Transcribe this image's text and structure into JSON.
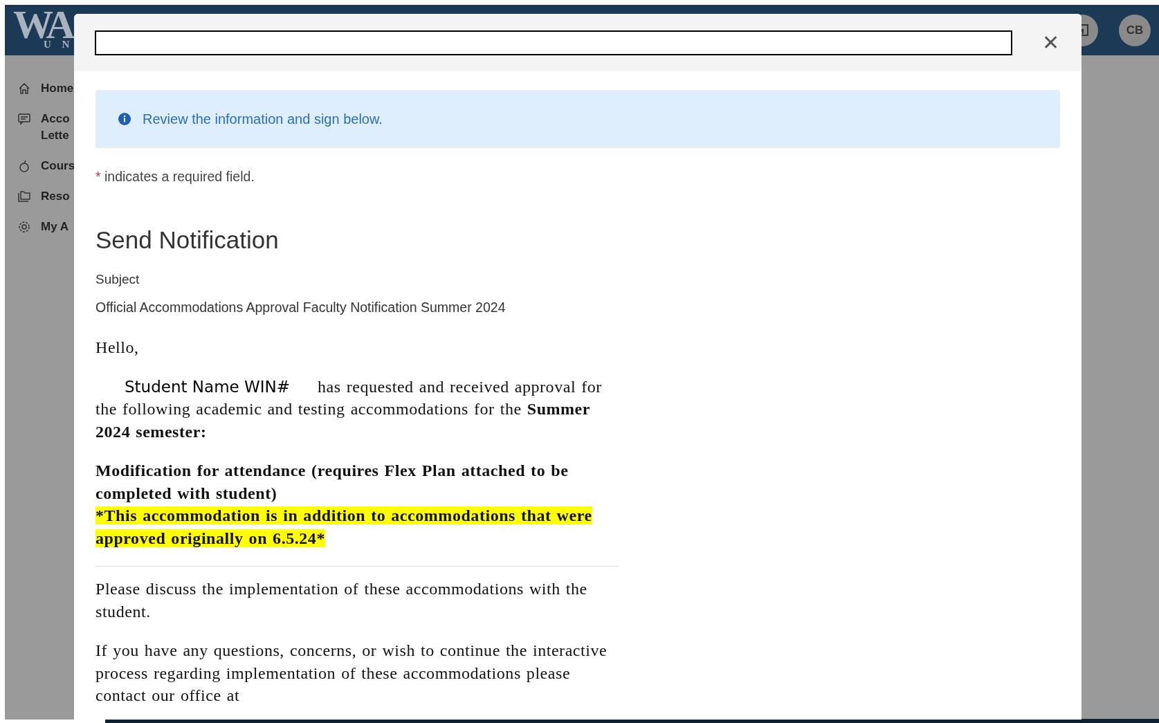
{
  "header": {
    "logo_text": "WA",
    "logo_subtext": "U N",
    "avatar": "CB"
  },
  "sidebar": {
    "items": [
      {
        "label": "Home"
      },
      {
        "label": "Acco",
        "label_line2": "Lette"
      },
      {
        "label": "Cours"
      },
      {
        "label": "Reso"
      },
      {
        "label": "My A"
      }
    ]
  },
  "modal": {
    "close": "✕",
    "info": "Review the information and sign below.",
    "required_mark": "*",
    "required_note": "indicates a required field.",
    "heading": "Send Notification",
    "subject_label": "Subject",
    "subject_value": "Official Accommodations Approval Faculty Notification Summer 2024",
    "greeting": "Hello,",
    "student_placeholder": "Student Name WIN#",
    "intro": "has requested and received approval for the following academic and testing accommodations for the **Summer 2024 semester:**",
    "accommodation": "Modification for attendance (requires Flex Plan attached to be completed with student)",
    "highlight": "*This accommodation is in addition to accommodations that were approved originally on 6.5.24*",
    "paragraphs": [
      "Please discuss the implementation of these accommodations with the student.",
      "If you have any questions, concerns, or wish to continue the interactive process regarding implementation of these accommodations please contact our office at"
    ]
  }
}
